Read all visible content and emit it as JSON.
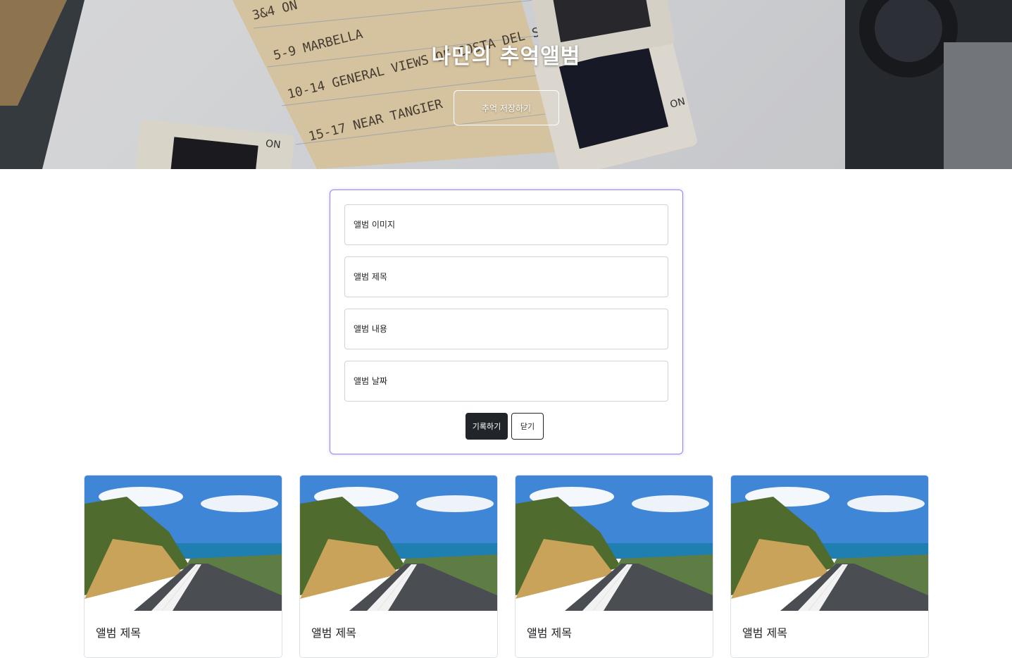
{
  "hero": {
    "title": "나만의 추억앨범",
    "button_label": "추억 저장하기"
  },
  "form": {
    "fields": [
      {
        "placeholder": "앨범 이미지"
      },
      {
        "placeholder": "앨범 제목"
      },
      {
        "placeholder": "앨범 내용"
      },
      {
        "placeholder": "앨범 날짜"
      }
    ],
    "submit_label": "기록하기",
    "close_label": "닫기"
  },
  "cards": [
    {
      "title": "앨범 제목"
    },
    {
      "title": "앨범 제목"
    },
    {
      "title": "앨범 제목"
    },
    {
      "title": "앨범 제목"
    }
  ],
  "colors": {
    "form_border": "#8f88f0",
    "dark_button": "#212529"
  }
}
